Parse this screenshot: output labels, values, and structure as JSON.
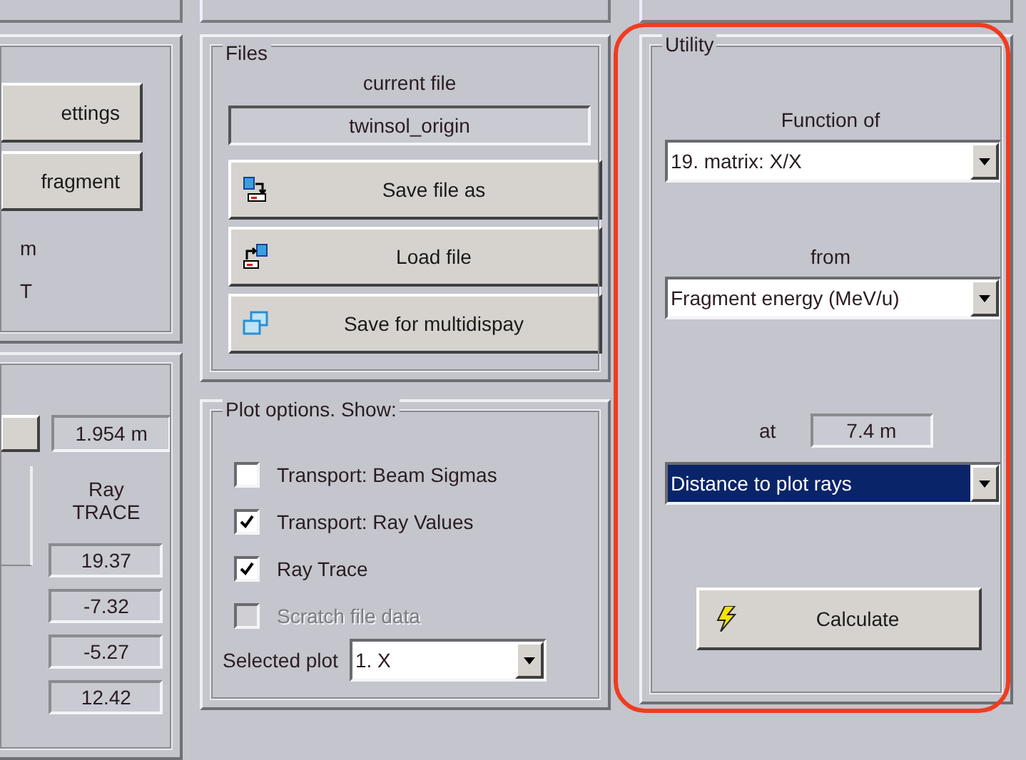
{
  "left_panel": {
    "buttons": [
      "ettings",
      "fragment"
    ],
    "labels": [
      "m",
      "T"
    ]
  },
  "ray_panel": {
    "distance": "1.954 m",
    "column_title": "Ray\nTRACE",
    "values": [
      "19.37",
      "-7.32",
      "-5.27",
      "12.42"
    ]
  },
  "files": {
    "title": "Files",
    "current_label": "current file",
    "current_file": "twinsol_origin",
    "buttons": [
      {
        "label": "Save file as",
        "kind": "save"
      },
      {
        "label": "Load file",
        "kind": "load"
      },
      {
        "label": "Save for multidispay",
        "kind": "multi"
      }
    ]
  },
  "plot_options": {
    "title": "Plot options. Show:",
    "options": [
      {
        "label": "Transport: Beam Sigmas",
        "checked": false,
        "disabled": false
      },
      {
        "label": "Transport: Ray Values",
        "checked": true,
        "disabled": false
      },
      {
        "label": "Ray Trace",
        "checked": true,
        "disabled": false
      },
      {
        "label": "Scratch file data",
        "checked": false,
        "disabled": true
      }
    ],
    "selected_plot_label": "Selected plot",
    "selected_plot": "1. X"
  },
  "utility": {
    "title": "Utility",
    "function_label": "Function of",
    "function_select": {
      "value": "19. matrix: X/X",
      "highlighted": false
    },
    "from_label": "from",
    "from_select": {
      "value": "Fragment energy (MeV/u)",
      "highlighted": false
    },
    "at_label": "at",
    "at_value": "7.4 m",
    "at_select": {
      "value": "Distance to plot rays",
      "highlighted": true
    },
    "calculate": "Calculate"
  }
}
